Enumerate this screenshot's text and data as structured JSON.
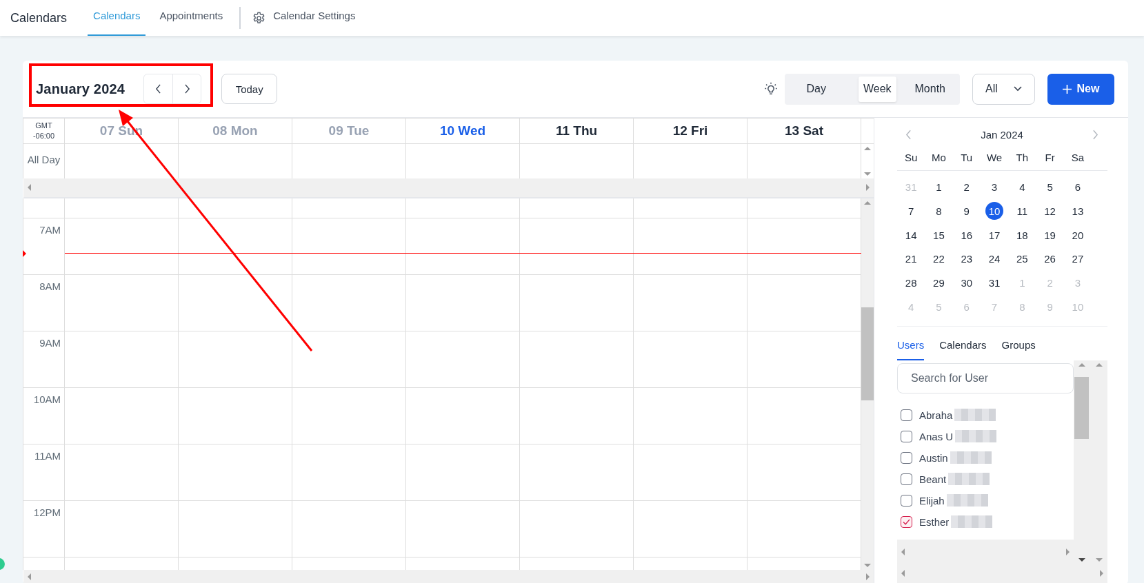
{
  "nav": {
    "title": "Calendars",
    "tabs": [
      {
        "label": "Calendars",
        "selected": true
      },
      {
        "label": "Appointments",
        "selected": false
      }
    ],
    "settings": "Calendar Settings"
  },
  "toolbar": {
    "month_label": "January 2024",
    "today": "Today",
    "views": [
      {
        "label": "Day",
        "selected": false
      },
      {
        "label": "Week",
        "selected": true
      },
      {
        "label": "Month",
        "selected": false
      }
    ],
    "filter": "All",
    "new_button": "New"
  },
  "grid": {
    "timezone": [
      "GMT",
      "-06:00"
    ],
    "all_day": "All Day",
    "days": [
      {
        "label": "07 Sun",
        "kind": "past"
      },
      {
        "label": "08 Mon",
        "kind": "past"
      },
      {
        "label": "09 Tue",
        "kind": "past"
      },
      {
        "label": "10 Wed",
        "kind": "today"
      },
      {
        "label": "11 Thu",
        "kind": "future"
      },
      {
        "label": "12 Fri",
        "kind": "future"
      },
      {
        "label": "13 Sat",
        "kind": "future"
      }
    ],
    "hours": [
      "7AM",
      "8AM",
      "9AM",
      "10AM",
      "11AM",
      "12PM"
    ]
  },
  "mini_calendar": {
    "title": "Jan 2024",
    "weekdays": [
      "Su",
      "Mo",
      "Tu",
      "We",
      "Th",
      "Fr",
      "Sa"
    ],
    "weeks": [
      [
        {
          "day": "31",
          "muted": true,
          "selected": false
        },
        {
          "day": "1",
          "muted": false,
          "selected": false
        },
        {
          "day": "2",
          "muted": false,
          "selected": false
        },
        {
          "day": "3",
          "muted": false,
          "selected": false
        },
        {
          "day": "4",
          "muted": false,
          "selected": false
        },
        {
          "day": "5",
          "muted": false,
          "selected": false
        },
        {
          "day": "6",
          "muted": false,
          "selected": false
        }
      ],
      [
        {
          "day": "7",
          "muted": false,
          "selected": false
        },
        {
          "day": "8",
          "muted": false,
          "selected": false
        },
        {
          "day": "9",
          "muted": false,
          "selected": false
        },
        {
          "day": "10",
          "muted": false,
          "selected": true
        },
        {
          "day": "11",
          "muted": false,
          "selected": false
        },
        {
          "day": "12",
          "muted": false,
          "selected": false
        },
        {
          "day": "13",
          "muted": false,
          "selected": false
        }
      ],
      [
        {
          "day": "14",
          "muted": false,
          "selected": false
        },
        {
          "day": "15",
          "muted": false,
          "selected": false
        },
        {
          "day": "16",
          "muted": false,
          "selected": false
        },
        {
          "day": "17",
          "muted": false,
          "selected": false
        },
        {
          "day": "18",
          "muted": false,
          "selected": false
        },
        {
          "day": "19",
          "muted": false,
          "selected": false
        },
        {
          "day": "20",
          "muted": false,
          "selected": false
        }
      ],
      [
        {
          "day": "21",
          "muted": false,
          "selected": false
        },
        {
          "day": "22",
          "muted": false,
          "selected": false
        },
        {
          "day": "23",
          "muted": false,
          "selected": false
        },
        {
          "day": "24",
          "muted": false,
          "selected": false
        },
        {
          "day": "25",
          "muted": false,
          "selected": false
        },
        {
          "day": "26",
          "muted": false,
          "selected": false
        },
        {
          "day": "27",
          "muted": false,
          "selected": false
        }
      ],
      [
        {
          "day": "28",
          "muted": false,
          "selected": false
        },
        {
          "day": "29",
          "muted": false,
          "selected": false
        },
        {
          "day": "30",
          "muted": false,
          "selected": false
        },
        {
          "day": "31",
          "muted": false,
          "selected": false
        },
        {
          "day": "1",
          "muted": true,
          "selected": false
        },
        {
          "day": "2",
          "muted": true,
          "selected": false
        },
        {
          "day": "3",
          "muted": true,
          "selected": false
        }
      ],
      [
        {
          "day": "4",
          "muted": true,
          "selected": false
        },
        {
          "day": "5",
          "muted": true,
          "selected": false
        },
        {
          "day": "6",
          "muted": true,
          "selected": false
        },
        {
          "day": "7",
          "muted": true,
          "selected": false
        },
        {
          "day": "8",
          "muted": true,
          "selected": false
        },
        {
          "day": "9",
          "muted": true,
          "selected": false
        },
        {
          "day": "10",
          "muted": true,
          "selected": false
        }
      ]
    ]
  },
  "people": {
    "tabs": [
      {
        "label": "Users",
        "selected": true
      },
      {
        "label": "Calendars",
        "selected": false
      },
      {
        "label": "Groups",
        "selected": false
      }
    ],
    "search": {
      "placeholder": "Search for User"
    },
    "users": [
      {
        "name": "Abraha",
        "checked": false
      },
      {
        "name": "Anas U",
        "checked": false
      },
      {
        "name": "Austin",
        "checked": false
      },
      {
        "name": "Beant",
        "checked": false
      },
      {
        "name": "Elijah",
        "checked": false
      },
      {
        "name": "Esther",
        "checked": true
      }
    ]
  }
}
